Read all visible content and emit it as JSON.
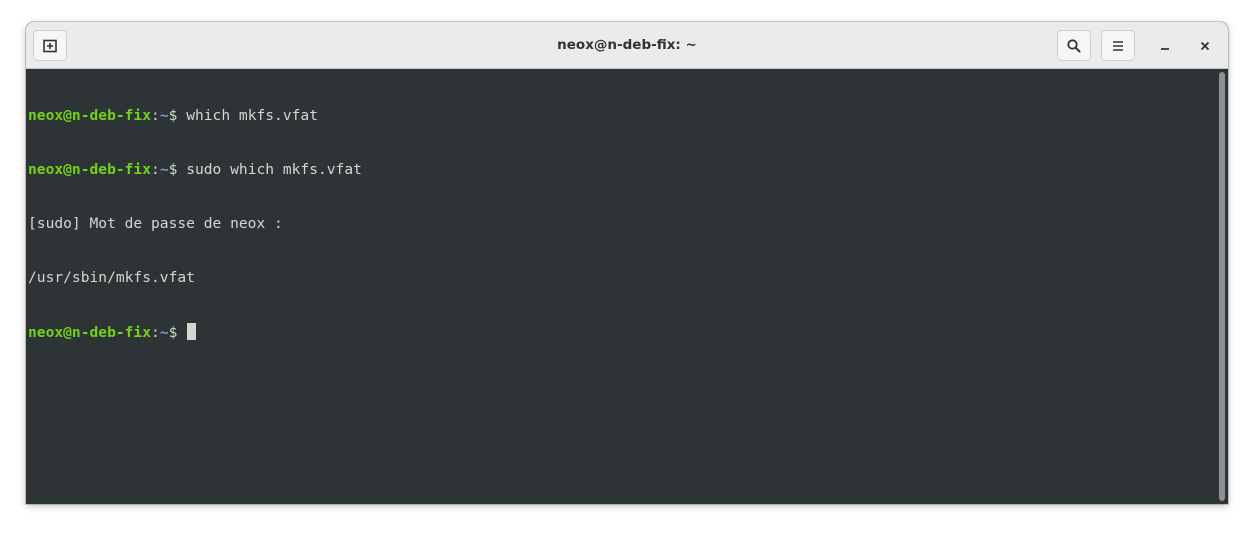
{
  "window": {
    "title": "neox@n-deb-fix: ~"
  },
  "headerbar": {
    "new_tab_icon": "new-tab-icon",
    "search_icon": "search-icon",
    "menu_icon": "hamburger-menu-icon",
    "minimize_icon": "minimize-icon",
    "close_icon": "close-icon"
  },
  "terminal": {
    "prompt_user": "neox@n-deb-fix",
    "prompt_sep": ":",
    "prompt_path": "~",
    "prompt_symbol": "$ ",
    "lines": [
      {
        "type": "prompt",
        "command": "which mkfs.vfat"
      },
      {
        "type": "prompt",
        "command": "sudo which mkfs.vfat"
      },
      {
        "type": "output",
        "text": "[sudo] Mot de passe de neox :"
      },
      {
        "type": "output",
        "text": "/usr/sbin/mkfs.vfat"
      },
      {
        "type": "prompt",
        "command": ""
      }
    ]
  },
  "colors": {
    "background": "#2e3436",
    "foreground": "#d3d7cf",
    "prompt_user": "#73d216",
    "prompt_path": "#729fcf",
    "headerbar": "#ebebeb"
  }
}
